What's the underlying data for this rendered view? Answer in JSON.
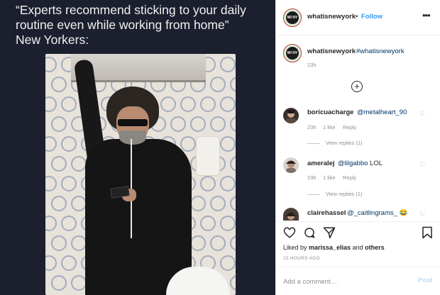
{
  "post": {
    "caption_lines": [
      "“Experts recommend sticking to your daily",
      "routine even while working from home”",
      "New Yorkers:"
    ],
    "logo_text": "WI NY"
  },
  "header": {
    "username": "whatisnewyork",
    "separator": "•",
    "follow_label": "Follow",
    "more_icon": "more-horizontal-icon"
  },
  "caption": {
    "username": "whatisnewyork",
    "hashtag": "#whatisnewyork",
    "time": "23h",
    "load_more_icon": "plus-circle-icon",
    "load_more_symbol": "+"
  },
  "comments": [
    {
      "username": "boricuacharge",
      "mention": "@metalheart_90",
      "text": "",
      "time": "23h",
      "likes": "1 like",
      "reply_label": "Reply",
      "view_replies": "View replies (1)"
    },
    {
      "username": "ameralej",
      "mention": "@lilgabbo",
      "text": " LOL",
      "time": "23h",
      "likes": "1 like",
      "reply_label": "Reply",
      "view_replies": "View replies (1)"
    },
    {
      "username": "clairehassel",
      "mention": "@_caitlingrams_",
      "text": " 😂",
      "time": "",
      "likes": "",
      "reply_label": "",
      "view_replies": ""
    }
  ],
  "actions": {
    "like_icon": "heart-icon",
    "comment_icon": "comment-icon",
    "share_icon": "send-icon",
    "save_icon": "bookmark-icon",
    "heart_symbol": "♡"
  },
  "likes": {
    "prefix": "Liked by ",
    "user": "marissa_elias",
    "middle": " and ",
    "others": "others"
  },
  "posted_time": "23 HOURS AGO",
  "comment_box": {
    "placeholder": "Add a comment…",
    "post_label": "Post"
  },
  "colors": {
    "link_blue": "#3897f0",
    "mention_blue": "#003569",
    "post_disabled": "#b2dffc",
    "meme_bg": "#1b1f2e"
  }
}
